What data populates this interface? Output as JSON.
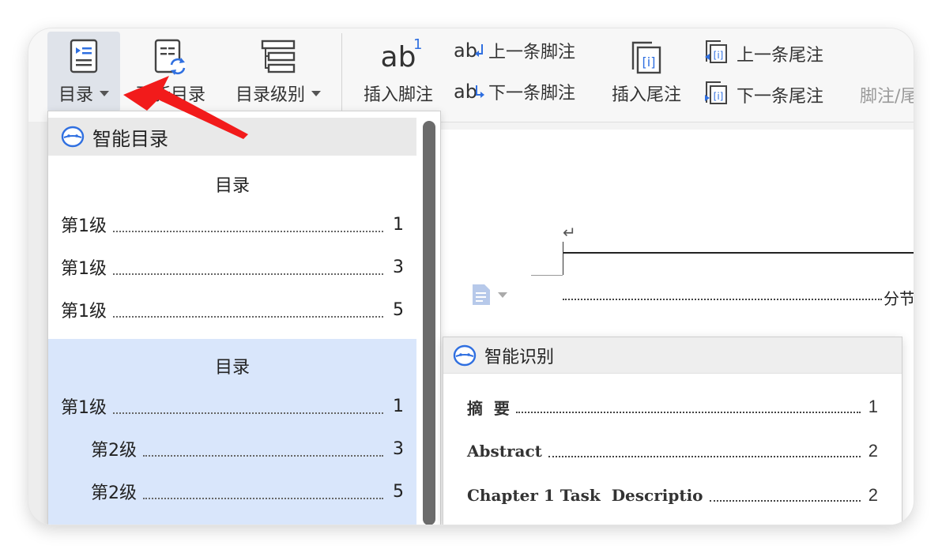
{
  "ribbon": {
    "toc_button": {
      "label": "目录",
      "icon": "toc-icon"
    },
    "update_toc": {
      "label": "更新目录",
      "icon": "refresh-doc-icon"
    },
    "toc_level": {
      "label": "目录级别",
      "icon": "level-icon"
    },
    "insert_footnote": {
      "label": "插入脚注",
      "icon_text": "ab",
      "icon_sup": "1"
    },
    "prev_footnote": {
      "label": "上一条脚注",
      "icon_text": "ab"
    },
    "next_footnote": {
      "label": "下一条脚注",
      "icon_text": "ab"
    },
    "insert_endnote": {
      "label": "插入尾注",
      "icon_text": "[i]"
    },
    "prev_endnote": {
      "label": "上一条尾注",
      "icon_text": "[i]"
    },
    "next_endnote": {
      "label": "下一条尾注",
      "icon_text": "[i]"
    },
    "footnote_group": {
      "label": "脚注/尾"
    }
  },
  "document": {
    "return_mark": "↵",
    "section_break": "分节"
  },
  "toc_dropdown": {
    "header": "智能目录",
    "cards": [
      {
        "title": "目录",
        "selected": false,
        "entries": [
          {
            "text": "第1级",
            "page": "1",
            "indent": 0
          },
          {
            "text": "第1级",
            "page": "3",
            "indent": 0
          },
          {
            "text": "第1级",
            "page": "5",
            "indent": 0
          }
        ]
      },
      {
        "title": "目录",
        "selected": true,
        "entries": [
          {
            "text": "第1级",
            "page": "1",
            "indent": 0
          },
          {
            "text": "第2级",
            "page": "3",
            "indent": 1
          },
          {
            "text": "第2级",
            "page": "5",
            "indent": 1
          }
        ]
      }
    ]
  },
  "smart_panel": {
    "header": "智能识别",
    "entries": [
      {
        "text": "摘  要",
        "page": "1"
      },
      {
        "text": "Abstract",
        "page": "2"
      },
      {
        "text": "Chapter 1 Task  Descriptio",
        "page": "2"
      }
    ]
  },
  "colors": {
    "selected_card": "#d9e6fb",
    "annotation_arrow": "#f21b1b",
    "face_icon": "#2f6fe0"
  }
}
